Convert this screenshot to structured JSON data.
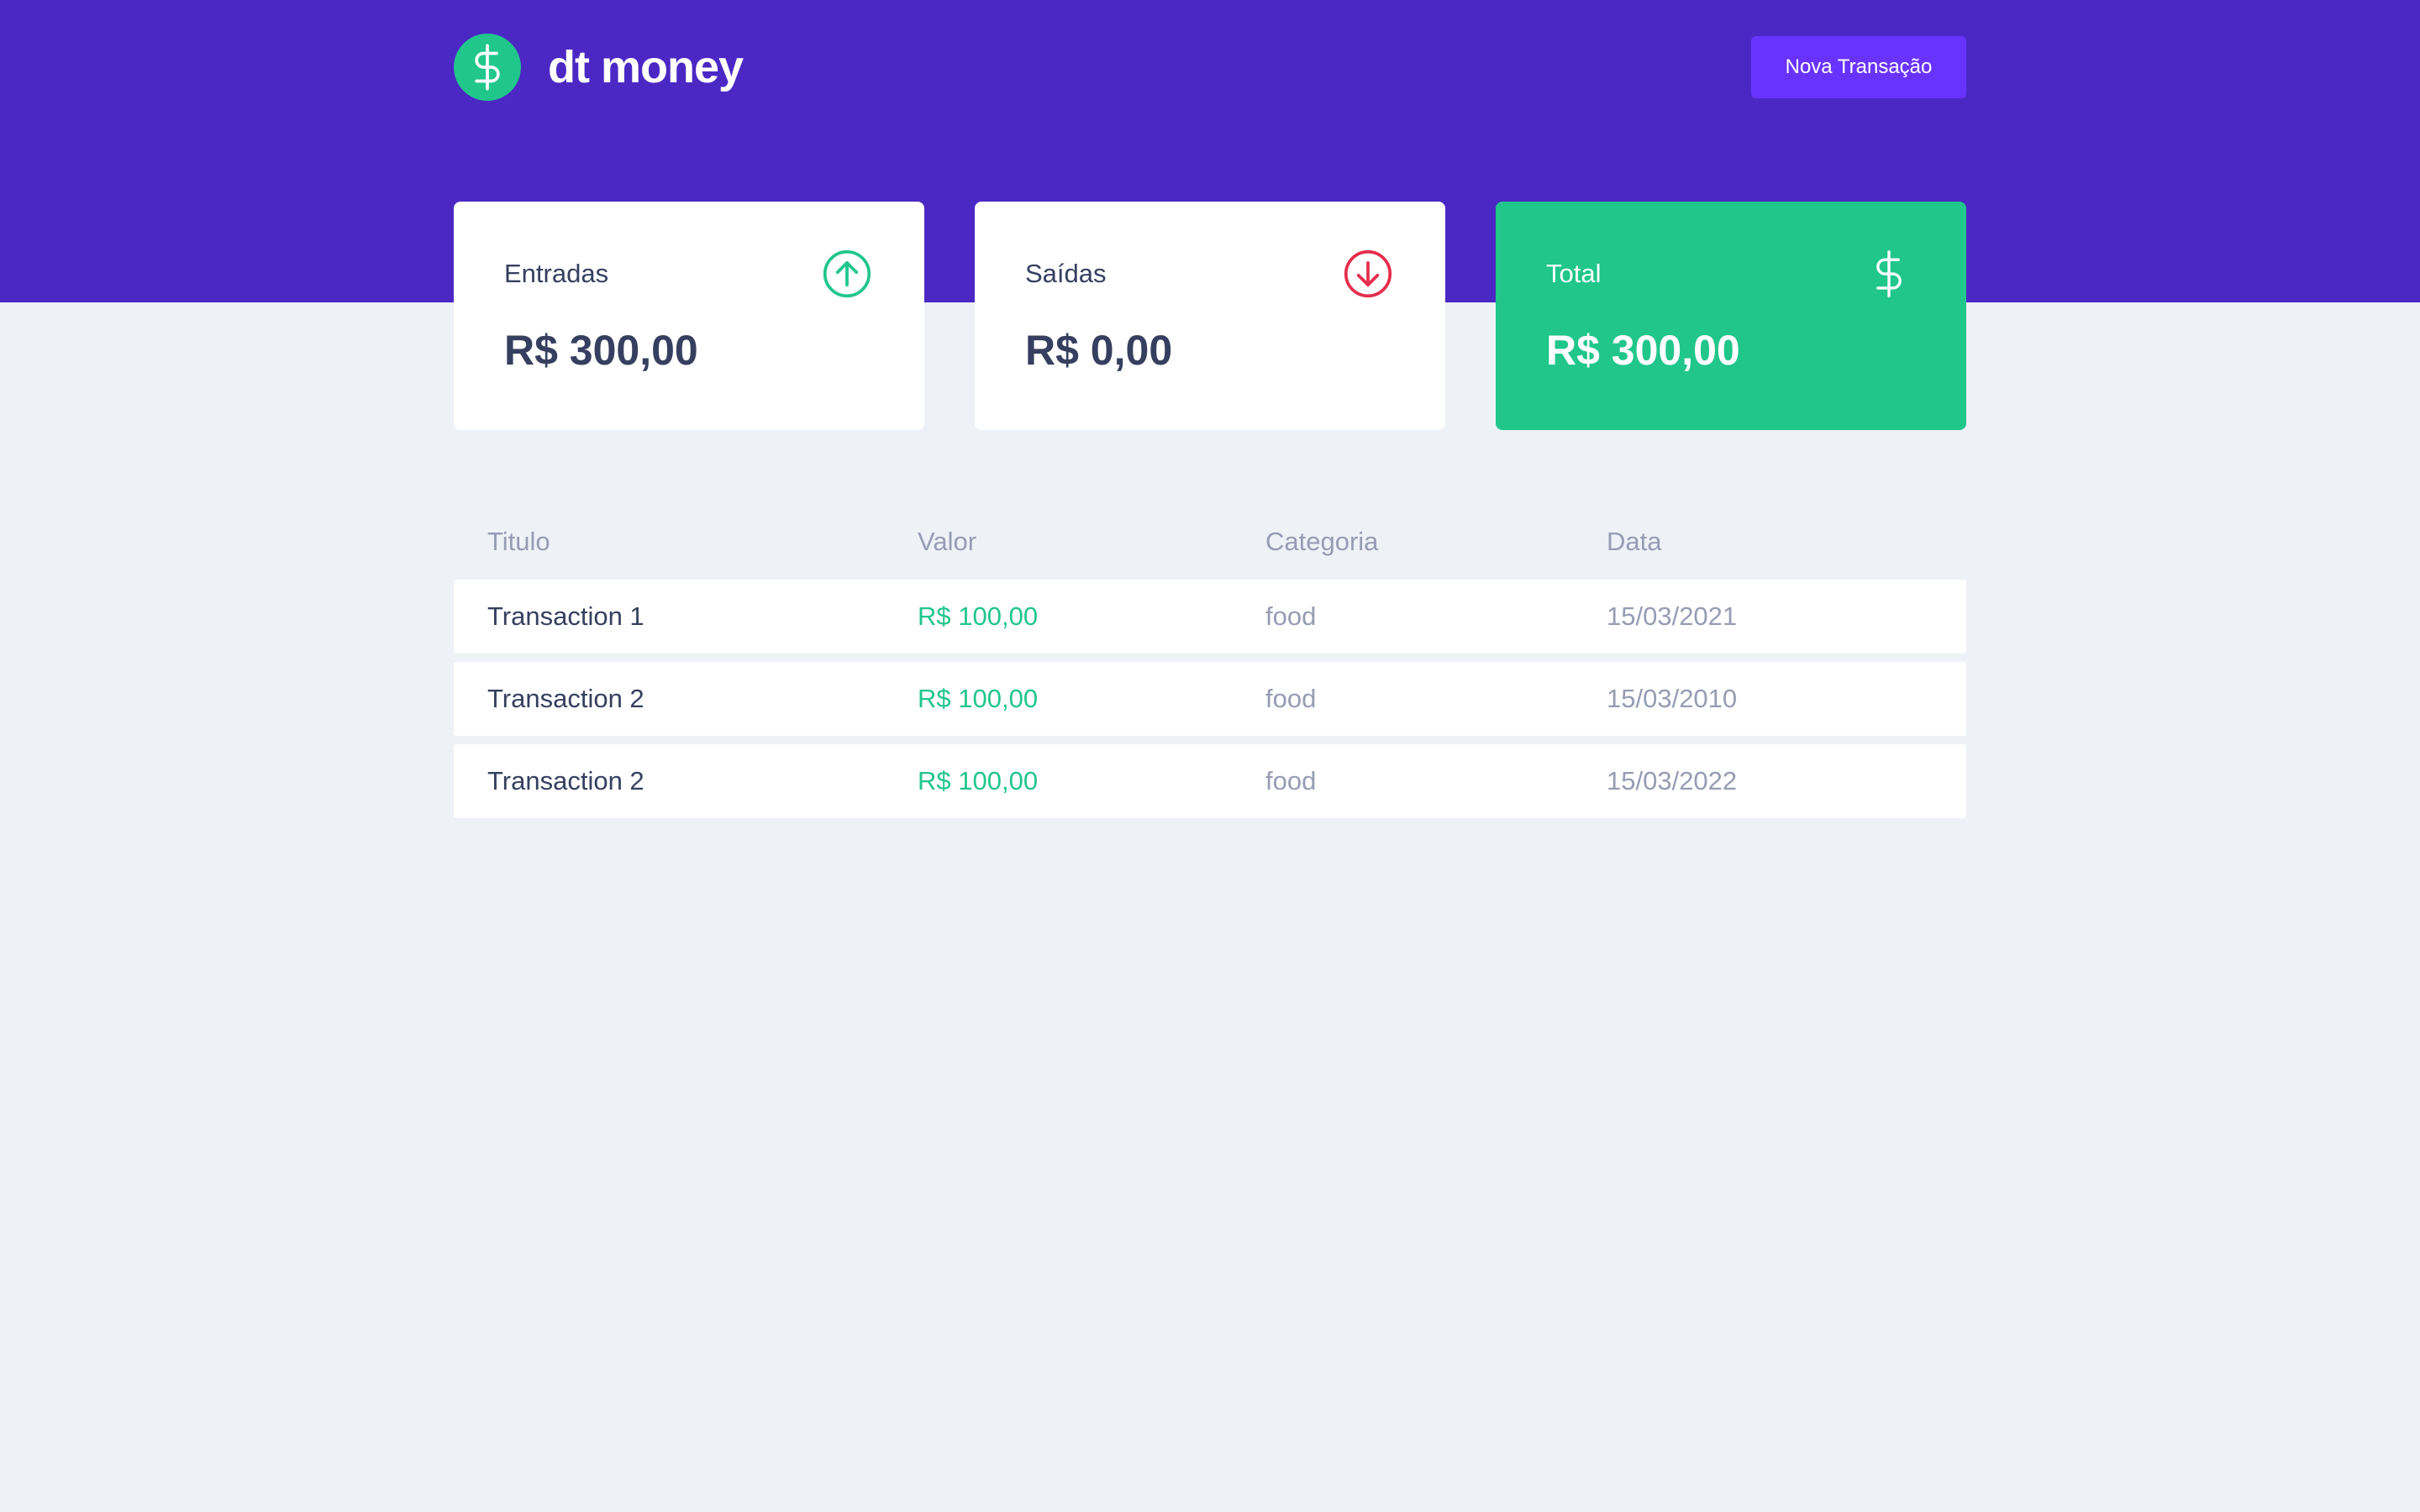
{
  "header": {
    "logo_text": "dt money",
    "logo_icon": "dollar-sign-icon",
    "new_transaction_label": "Nova Transação"
  },
  "summary": {
    "income": {
      "label": "Entradas",
      "amount": "R$ 300,00",
      "icon": "arrow-up-circle-icon"
    },
    "outcome": {
      "label": "Saídas",
      "amount": "R$ 0,00",
      "icon": "arrow-down-circle-icon"
    },
    "total": {
      "label": "Total",
      "amount": "R$ 300,00",
      "icon": "dollar-sign-icon"
    }
  },
  "table": {
    "columns": [
      "Titulo",
      "Valor",
      "Categoria",
      "Data"
    ],
    "rows": [
      {
        "title": "Transaction 1",
        "value": "R$ 100,00",
        "category": "food",
        "date": "15/03/2021"
      },
      {
        "title": "Transaction 2",
        "value": "R$ 100,00",
        "category": "food",
        "date": "15/03/2010"
      },
      {
        "title": "Transaction 2",
        "value": "R$ 100,00",
        "category": "food",
        "date": "15/03/2022"
      }
    ]
  },
  "colors": {
    "header_bg": "#4b28c4",
    "green": "#21c68b",
    "red": "#e52e4d",
    "button": "#6933ff",
    "text_title": "#363f5f",
    "text_body": "#969cb3",
    "background": "#eef1f6"
  }
}
